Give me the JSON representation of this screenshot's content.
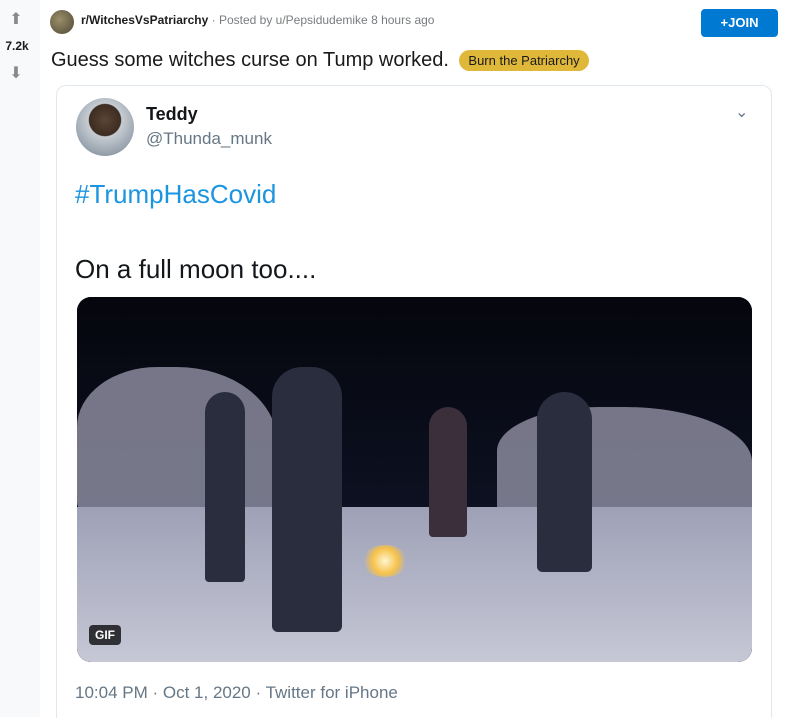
{
  "vote": {
    "count": "7.2k",
    "up_icon": "arrow-up-icon",
    "down_icon": "arrow-down-icon"
  },
  "header": {
    "subreddit": "r/WitchesVsPatriarchy",
    "separator": " · ",
    "posted_by": "Posted by u/Pepsidudemike",
    "time": "8 hours ago",
    "join_label": "JOIN",
    "join_prefix": "+"
  },
  "post": {
    "title": "Guess some witches curse on Tump worked.",
    "flair": "Burn the Patriarchy",
    "flair_color": "#dfb83a"
  },
  "tweet": {
    "name": "Teddy",
    "handle": "@Thunda_munk",
    "hashtag": "#TrumpHasCovid",
    "text": "On a full moon too....",
    "media_badge": "GIF",
    "time": "10:04 PM",
    "separator": " · ",
    "date": "Oct 1, 2020",
    "source": "Twitter for iPhone",
    "hashtag_color": "#1b95e0"
  },
  "colors": {
    "join_button": "#0079d3",
    "vote_bg": "#f8f9fa"
  }
}
